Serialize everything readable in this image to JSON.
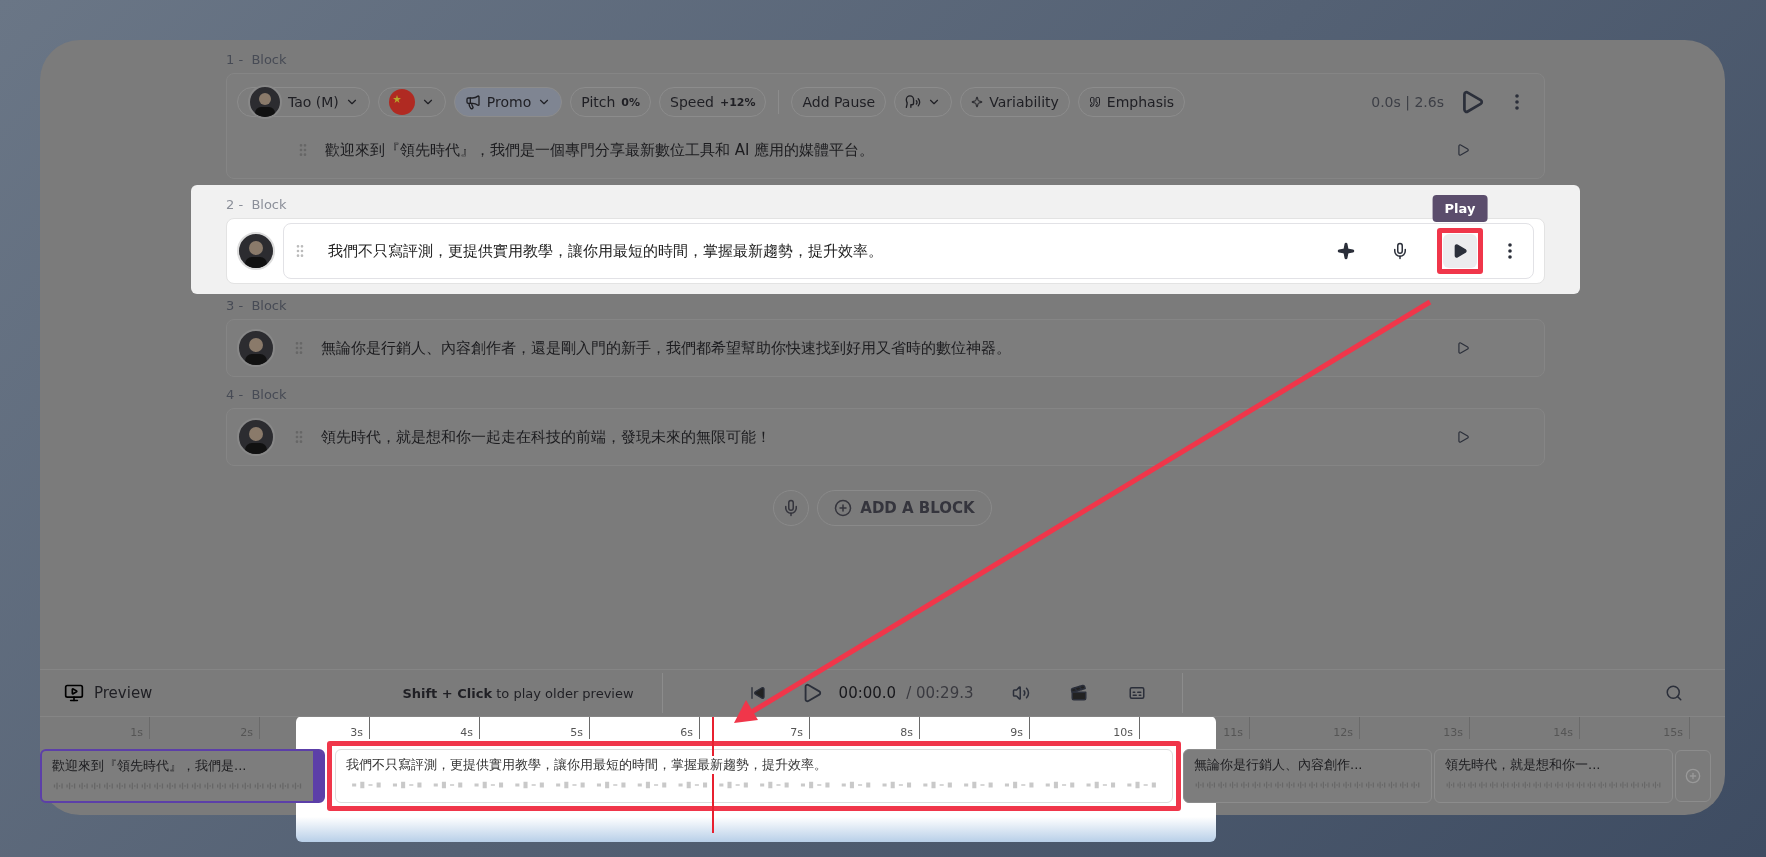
{
  "blocks": [
    {
      "number": "1 -",
      "title": "Block",
      "text": "歡迎來到『領先時代』，我們是一個專門分享最新數位工具和 AI 應用的媒體平台。",
      "selected": false,
      "toolbar": {
        "voice": "Tao (M)",
        "style": "Promo",
        "pitch_label": "Pitch",
        "pitch": "0%",
        "speed_label": "Speed",
        "speed": "+12%",
        "pause": "Add Pause",
        "variability": "Variability",
        "emphasis": "Emphasis",
        "duration": "0.0s | 2.6s"
      }
    },
    {
      "number": "2 -",
      "title": "Block",
      "text": "我們不只寫評測，更提供實用教學，讓你用最短的時間，掌握最新趨勢，提升效率。",
      "selected": true,
      "tooltip": "Play"
    },
    {
      "number": "3 -",
      "title": "Block",
      "text": "無論你是行銷人、內容創作者，還是剛入門的新手，我們都希望幫助你快速找到好用又省時的數位神器。",
      "selected": false
    },
    {
      "number": "4 -",
      "title": "Block",
      "text": "領先時代，就是想和你一起走在科技的前端，發現未來的無限可能！",
      "selected": false
    }
  ],
  "add_block": "ADD A BLOCK",
  "preview": {
    "label": "Preview",
    "hint": "**Shift + Click** to play older preview",
    "current_time": "00:00.0",
    "total_time": "/ 00:29.3"
  },
  "timeline": {
    "ruler": [
      "1s",
      "2s",
      "3s",
      "4s",
      "5s",
      "6s",
      "7s",
      "8s",
      "9s",
      "10s",
      "11s",
      "12s",
      "13s",
      "14s",
      "15s"
    ],
    "clips": [
      {
        "text": "歡迎來到『領先時代』，我們是...",
        "selected": true,
        "highlighted": false
      },
      {
        "text": "我們不只寫評測，更提供實用教學，讓你用最短的時間，掌握最新趨勢，提升效率。",
        "selected": false,
        "highlighted": true
      },
      {
        "text": "無論你是行銷人、內容創作...",
        "selected": false,
        "highlighted": false
      },
      {
        "text": "領先時代，就是想和你一...",
        "selected": false,
        "highlighted": false
      }
    ]
  }
}
